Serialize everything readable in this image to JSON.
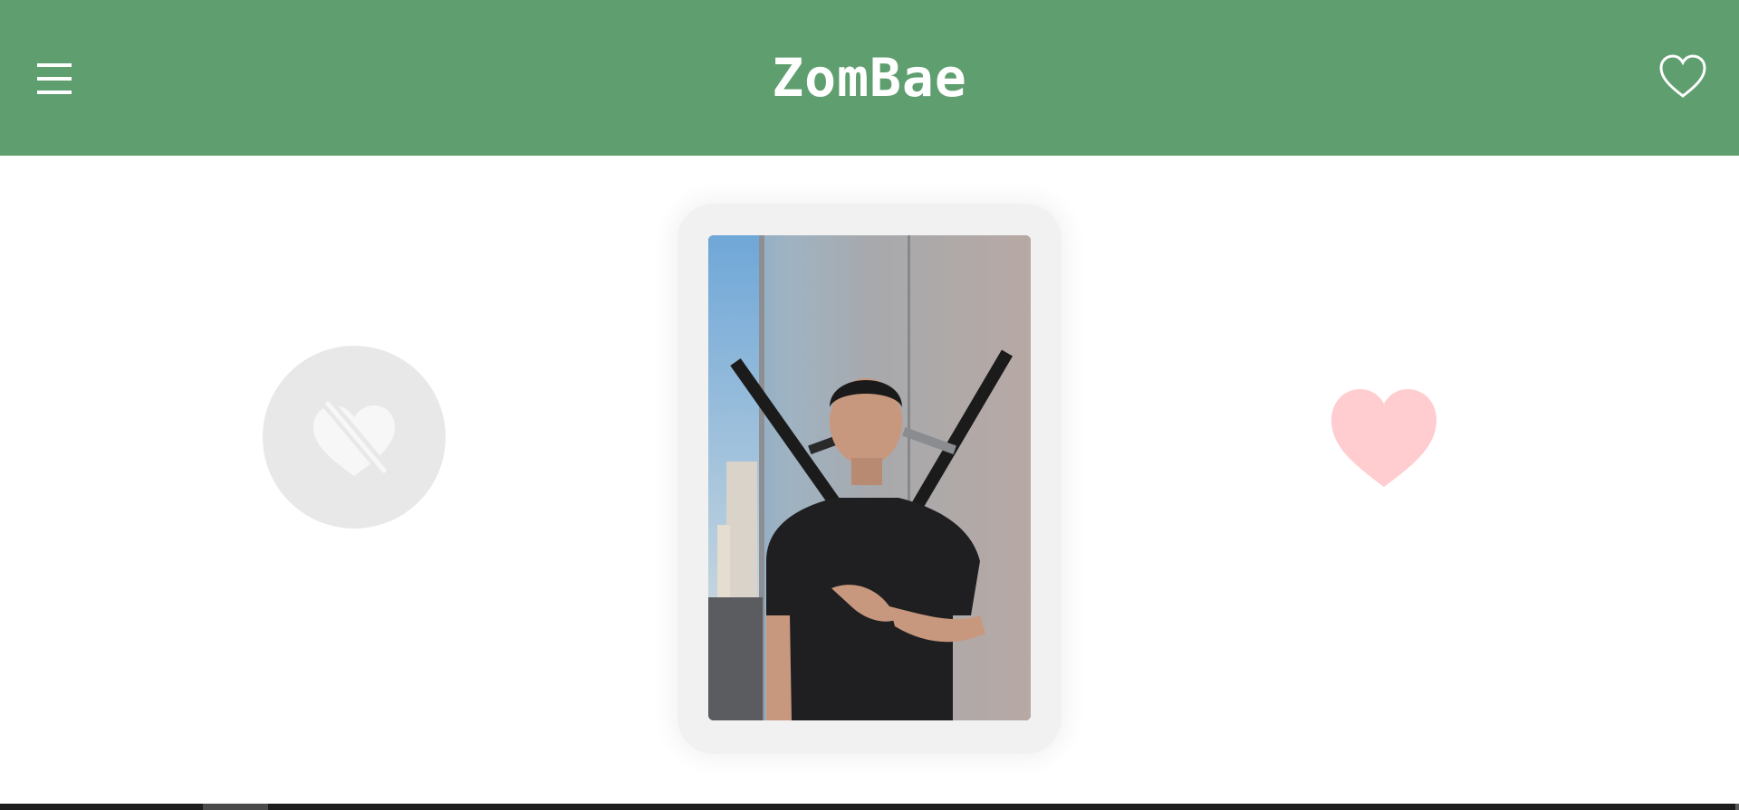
{
  "header": {
    "title": "ZomBae",
    "background_color": "#5f9f6f",
    "menu_icon": "hamburger-menu-icon",
    "favorites_icon": "heart-outline-icon"
  },
  "actions": {
    "dislike_icon": "heart-slash-icon",
    "dislike_color": "#e8e8e8",
    "like_icon": "heart-filled-icon",
    "like_color": "#ffcccf"
  },
  "profile_card": {
    "photo_description_icon": "profile-photo"
  }
}
